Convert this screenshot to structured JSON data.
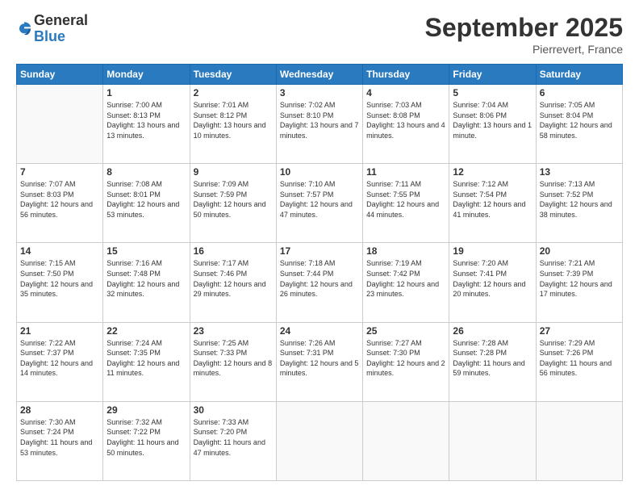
{
  "logo": {
    "general": "General",
    "blue": "Blue"
  },
  "header": {
    "month": "September 2025",
    "location": "Pierrevert, France"
  },
  "weekdays": [
    "Sunday",
    "Monday",
    "Tuesday",
    "Wednesday",
    "Thursday",
    "Friday",
    "Saturday"
  ],
  "weeks": [
    [
      {
        "day": "",
        "sunrise": "",
        "sunset": "",
        "daylight": ""
      },
      {
        "day": "1",
        "sunrise": "Sunrise: 7:00 AM",
        "sunset": "Sunset: 8:13 PM",
        "daylight": "Daylight: 13 hours and 13 minutes."
      },
      {
        "day": "2",
        "sunrise": "Sunrise: 7:01 AM",
        "sunset": "Sunset: 8:12 PM",
        "daylight": "Daylight: 13 hours and 10 minutes."
      },
      {
        "day": "3",
        "sunrise": "Sunrise: 7:02 AM",
        "sunset": "Sunset: 8:10 PM",
        "daylight": "Daylight: 13 hours and 7 minutes."
      },
      {
        "day": "4",
        "sunrise": "Sunrise: 7:03 AM",
        "sunset": "Sunset: 8:08 PM",
        "daylight": "Daylight: 13 hours and 4 minutes."
      },
      {
        "day": "5",
        "sunrise": "Sunrise: 7:04 AM",
        "sunset": "Sunset: 8:06 PM",
        "daylight": "Daylight: 13 hours and 1 minute."
      },
      {
        "day": "6",
        "sunrise": "Sunrise: 7:05 AM",
        "sunset": "Sunset: 8:04 PM",
        "daylight": "Daylight: 12 hours and 58 minutes."
      }
    ],
    [
      {
        "day": "7",
        "sunrise": "Sunrise: 7:07 AM",
        "sunset": "Sunset: 8:03 PM",
        "daylight": "Daylight: 12 hours and 56 minutes."
      },
      {
        "day": "8",
        "sunrise": "Sunrise: 7:08 AM",
        "sunset": "Sunset: 8:01 PM",
        "daylight": "Daylight: 12 hours and 53 minutes."
      },
      {
        "day": "9",
        "sunrise": "Sunrise: 7:09 AM",
        "sunset": "Sunset: 7:59 PM",
        "daylight": "Daylight: 12 hours and 50 minutes."
      },
      {
        "day": "10",
        "sunrise": "Sunrise: 7:10 AM",
        "sunset": "Sunset: 7:57 PM",
        "daylight": "Daylight: 12 hours and 47 minutes."
      },
      {
        "day": "11",
        "sunrise": "Sunrise: 7:11 AM",
        "sunset": "Sunset: 7:55 PM",
        "daylight": "Daylight: 12 hours and 44 minutes."
      },
      {
        "day": "12",
        "sunrise": "Sunrise: 7:12 AM",
        "sunset": "Sunset: 7:54 PM",
        "daylight": "Daylight: 12 hours and 41 minutes."
      },
      {
        "day": "13",
        "sunrise": "Sunrise: 7:13 AM",
        "sunset": "Sunset: 7:52 PM",
        "daylight": "Daylight: 12 hours and 38 minutes."
      }
    ],
    [
      {
        "day": "14",
        "sunrise": "Sunrise: 7:15 AM",
        "sunset": "Sunset: 7:50 PM",
        "daylight": "Daylight: 12 hours and 35 minutes."
      },
      {
        "day": "15",
        "sunrise": "Sunrise: 7:16 AM",
        "sunset": "Sunset: 7:48 PM",
        "daylight": "Daylight: 12 hours and 32 minutes."
      },
      {
        "day": "16",
        "sunrise": "Sunrise: 7:17 AM",
        "sunset": "Sunset: 7:46 PM",
        "daylight": "Daylight: 12 hours and 29 minutes."
      },
      {
        "day": "17",
        "sunrise": "Sunrise: 7:18 AM",
        "sunset": "Sunset: 7:44 PM",
        "daylight": "Daylight: 12 hours and 26 minutes."
      },
      {
        "day": "18",
        "sunrise": "Sunrise: 7:19 AM",
        "sunset": "Sunset: 7:42 PM",
        "daylight": "Daylight: 12 hours and 23 minutes."
      },
      {
        "day": "19",
        "sunrise": "Sunrise: 7:20 AM",
        "sunset": "Sunset: 7:41 PM",
        "daylight": "Daylight: 12 hours and 20 minutes."
      },
      {
        "day": "20",
        "sunrise": "Sunrise: 7:21 AM",
        "sunset": "Sunset: 7:39 PM",
        "daylight": "Daylight: 12 hours and 17 minutes."
      }
    ],
    [
      {
        "day": "21",
        "sunrise": "Sunrise: 7:22 AM",
        "sunset": "Sunset: 7:37 PM",
        "daylight": "Daylight: 12 hours and 14 minutes."
      },
      {
        "day": "22",
        "sunrise": "Sunrise: 7:24 AM",
        "sunset": "Sunset: 7:35 PM",
        "daylight": "Daylight: 12 hours and 11 minutes."
      },
      {
        "day": "23",
        "sunrise": "Sunrise: 7:25 AM",
        "sunset": "Sunset: 7:33 PM",
        "daylight": "Daylight: 12 hours and 8 minutes."
      },
      {
        "day": "24",
        "sunrise": "Sunrise: 7:26 AM",
        "sunset": "Sunset: 7:31 PM",
        "daylight": "Daylight: 12 hours and 5 minutes."
      },
      {
        "day": "25",
        "sunrise": "Sunrise: 7:27 AM",
        "sunset": "Sunset: 7:30 PM",
        "daylight": "Daylight: 12 hours and 2 minutes."
      },
      {
        "day": "26",
        "sunrise": "Sunrise: 7:28 AM",
        "sunset": "Sunset: 7:28 PM",
        "daylight": "Daylight: 11 hours and 59 minutes."
      },
      {
        "day": "27",
        "sunrise": "Sunrise: 7:29 AM",
        "sunset": "Sunset: 7:26 PM",
        "daylight": "Daylight: 11 hours and 56 minutes."
      }
    ],
    [
      {
        "day": "28",
        "sunrise": "Sunrise: 7:30 AM",
        "sunset": "Sunset: 7:24 PM",
        "daylight": "Daylight: 11 hours and 53 minutes."
      },
      {
        "day": "29",
        "sunrise": "Sunrise: 7:32 AM",
        "sunset": "Sunset: 7:22 PM",
        "daylight": "Daylight: 11 hours and 50 minutes."
      },
      {
        "day": "30",
        "sunrise": "Sunrise: 7:33 AM",
        "sunset": "Sunset: 7:20 PM",
        "daylight": "Daylight: 11 hours and 47 minutes."
      },
      {
        "day": "",
        "sunrise": "",
        "sunset": "",
        "daylight": ""
      },
      {
        "day": "",
        "sunrise": "",
        "sunset": "",
        "daylight": ""
      },
      {
        "day": "",
        "sunrise": "",
        "sunset": "",
        "daylight": ""
      },
      {
        "day": "",
        "sunrise": "",
        "sunset": "",
        "daylight": ""
      }
    ]
  ]
}
